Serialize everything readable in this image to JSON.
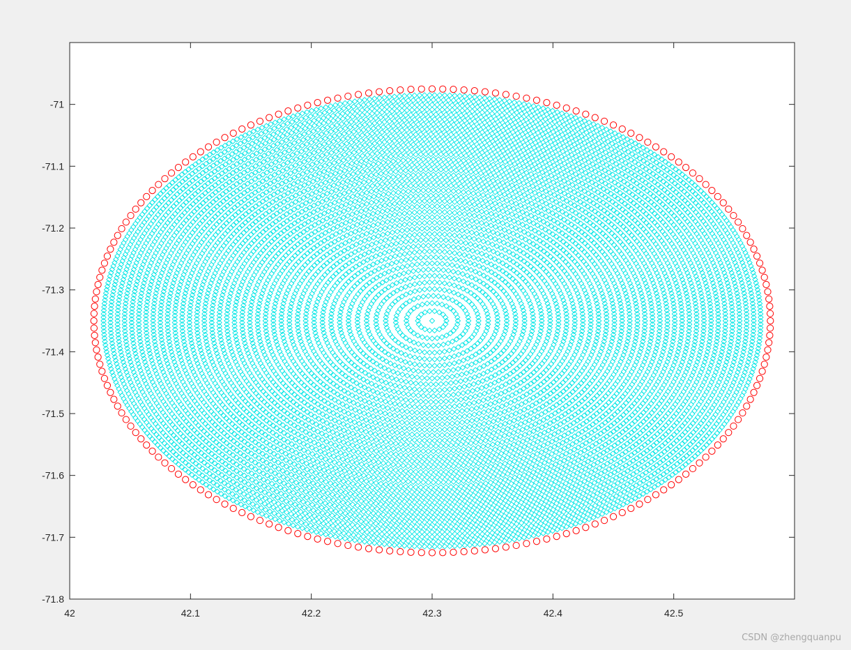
{
  "chart_data": {
    "type": "scatter",
    "title": "",
    "xlabel": "",
    "ylabel": "",
    "xlim": [
      42,
      42.6
    ],
    "ylim": [
      -71.8,
      -70.9
    ],
    "xticks": [
      "42",
      "42.1",
      "42.2",
      "42.3",
      "42.4",
      "42.5"
    ],
    "yticks": [
      "-71",
      "-71.1",
      "-71.2",
      "-71.3",
      "-71.4",
      "-71.5",
      "-71.6",
      "-71.7",
      "-71.8"
    ],
    "grid": false,
    "legend": "none",
    "center": {
      "x": 42.3,
      "y": -71.35
    },
    "series": [
      {
        "marker": "diamond",
        "color": "#00e6e6",
        "shape": "concentric ellipses",
        "rings": 40,
        "x_semi_axis_max": 0.272,
        "y_semi_axis_max": 0.365
      },
      {
        "marker": "circle",
        "color": "#ff0000",
        "shape": "boundary ellipse",
        "x_semi_axis": 0.28,
        "y_semi_axis": 0.375,
        "points": 200
      }
    ]
  },
  "watermark": "CSDN @zhengquanpu"
}
